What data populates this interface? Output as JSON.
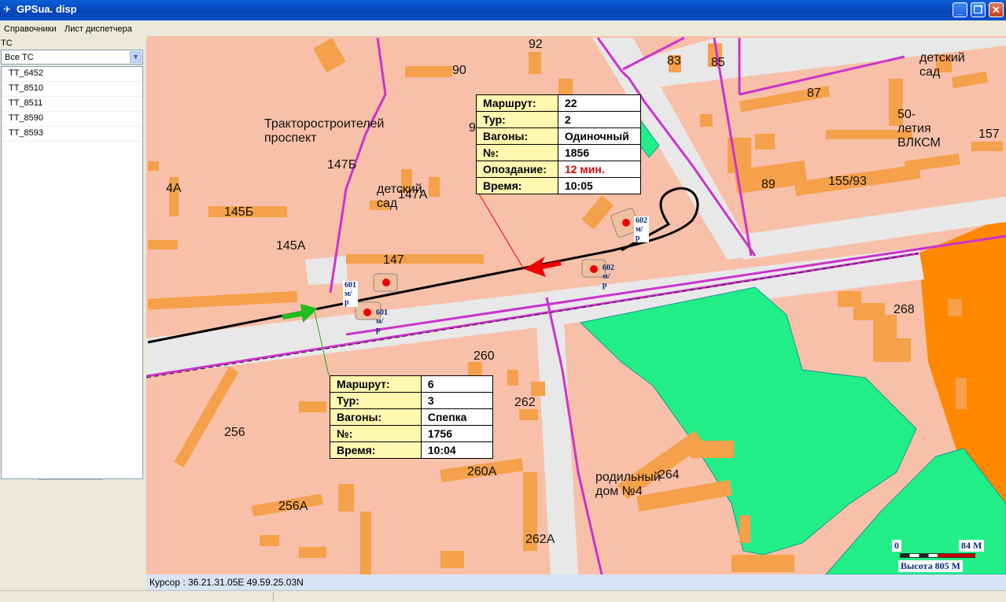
{
  "window": {
    "title": "GPSua. disp"
  },
  "menu": [
    "Справочники",
    "Лист диспетчера"
  ],
  "left": {
    "label": "ТС",
    "select_value": "Все ТС",
    "vehicles": [
      "TT_6452",
      "TT_8510",
      "TT_8511",
      "TT_8590",
      "TT_8593"
    ]
  },
  "map": {
    "labels": {
      "n92": "92",
      "n90": "90",
      "n83": "83",
      "n85": "85",
      "n87": "87",
      "kindergarten1": "детский сад",
      "vlksm": "50-летия ВЛКСМ",
      "n157": "157",
      "prospect": "Тракторостроителей проспект",
      "n9": "9",
      "n147b": "147Б",
      "n4a": "4А",
      "kindergarten2": "детский сад",
      "n147a": "147А",
      "n89": "89",
      "n155_93": "155/93",
      "n145b": "145Б",
      "n145a": "145А",
      "n147": "147",
      "n268": "268",
      "n260": "260",
      "n262": "262",
      "n256": "256",
      "n260a": "260А",
      "maternity": "родильный дом №4",
      "n264": "264",
      "n256a": "256А",
      "n262a": "262А"
    },
    "stops": {
      "s601a": "601 м/р",
      "s601b": "601 м/р",
      "s602a": "602 м/р",
      "s602b": "602 м/р"
    },
    "cursor": "Курсор : 36.21.31.05E 49.59.25.03N",
    "scale": {
      "zero": "0",
      "dist": "84 М",
      "height": "Высота 805 М"
    },
    "colors": {
      "building": "#f5a04a",
      "road": "#e8e8e8",
      "route": "#cc33cc",
      "park": "#22ee88",
      "background": "#f8c0a8",
      "orange_area": "#ff8800"
    }
  },
  "popup1": {
    "rows": [
      {
        "k": "Маршрут:",
        "v": "22"
      },
      {
        "k": "Тур:",
        "v": "2"
      },
      {
        "k": "Вагоны:",
        "v": "Одиночный"
      },
      {
        "k": "№:",
        "v": "1856"
      },
      {
        "k": "Опоздание:",
        "v": "12 мин."
      },
      {
        "k": "Время:",
        "v": "10:05"
      }
    ]
  },
  "popup2": {
    "rows": [
      {
        "k": "Маршрут:",
        "v": "6"
      },
      {
        "k": "Тур:",
        "v": "3"
      },
      {
        "k": "Вагоны:",
        "v": "Спепка"
      },
      {
        "k": "№:",
        "v": "1756"
      },
      {
        "k": "Время:",
        "v": "10:04"
      }
    ]
  }
}
